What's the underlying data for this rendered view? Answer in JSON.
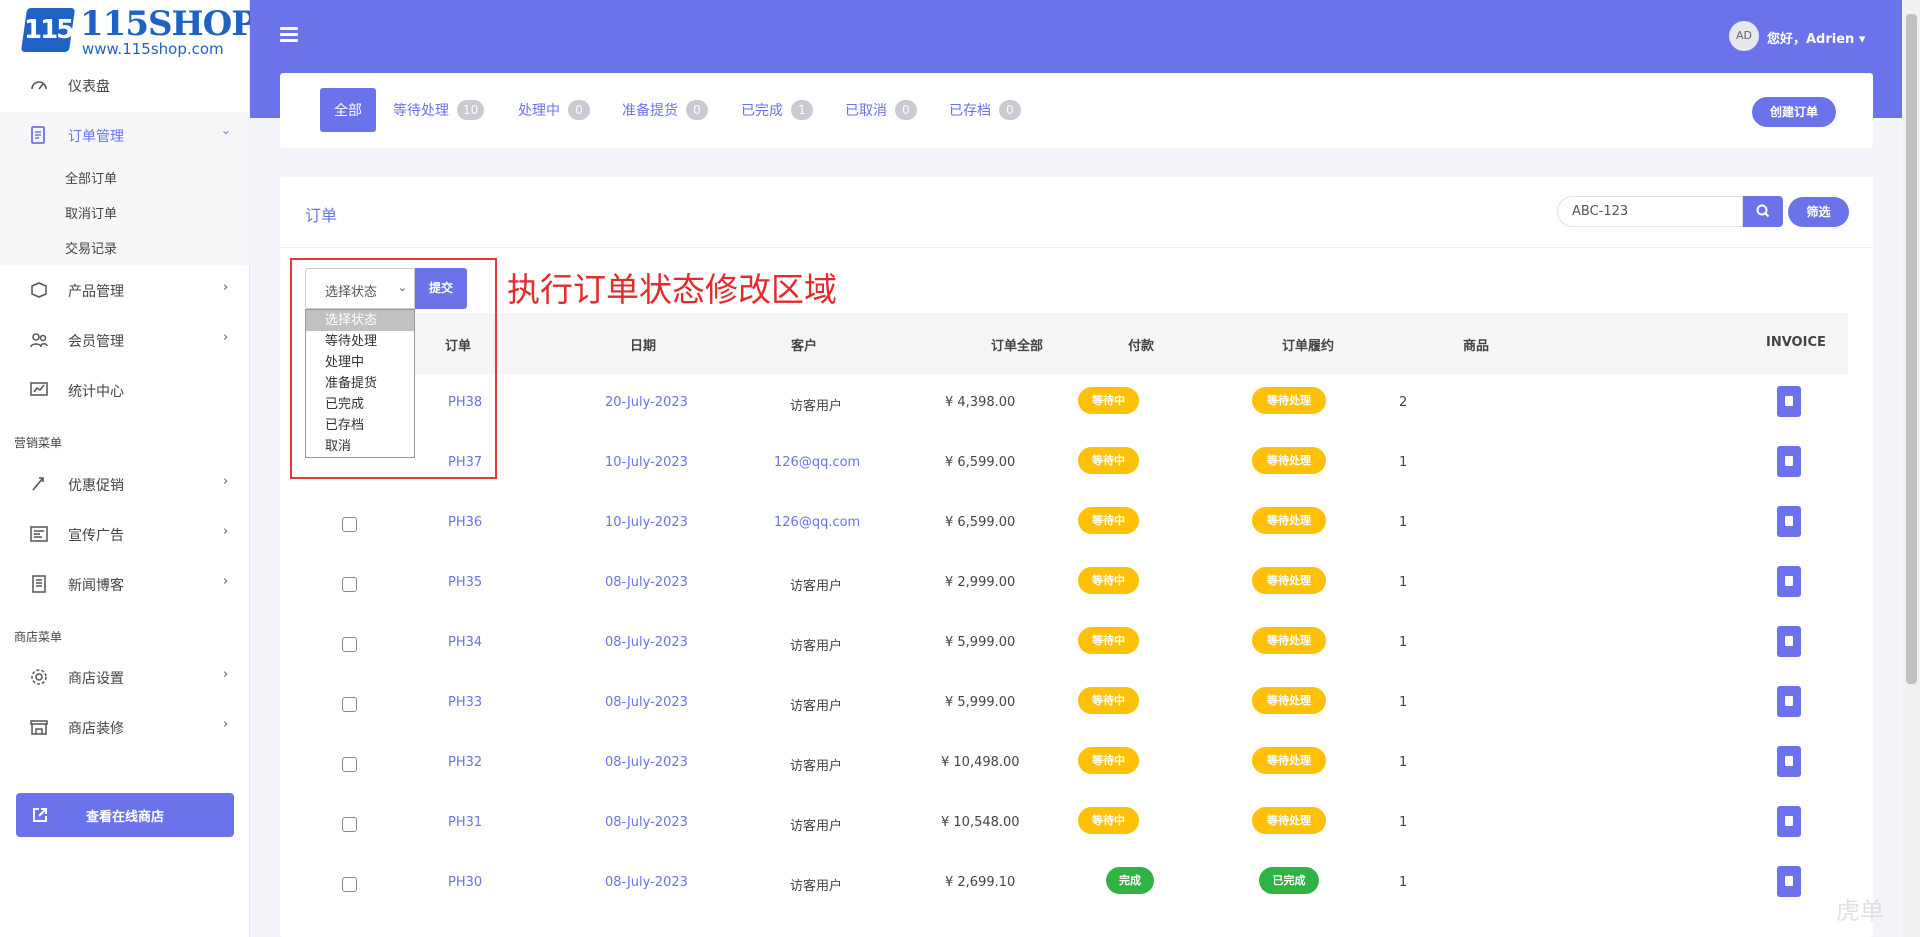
{
  "brand": {
    "name": "115SHOP",
    "url": "www.115shop.com",
    "mark": "115"
  },
  "header": {
    "avatar": "AD",
    "greeting": "您好，Adrien",
    "caret": "▾"
  },
  "sidebar": {
    "items": [
      {
        "label": "仪表盘",
        "icon": "dashboard-icon"
      },
      {
        "label": "订单管理",
        "icon": "order-icon",
        "expanded": true
      },
      {
        "label": "产品管理",
        "icon": "product-icon"
      },
      {
        "label": "会员管理",
        "icon": "members-icon"
      },
      {
        "label": "统计中心",
        "icon": "stats-icon"
      },
      {
        "label": "优惠促销",
        "icon": "promo-icon"
      },
      {
        "label": "宣传广告",
        "icon": "ads-icon"
      },
      {
        "label": "新闻博客",
        "icon": "news-icon"
      },
      {
        "label": "商店设置",
        "icon": "gear-icon"
      },
      {
        "label": "商店装修",
        "icon": "store-icon"
      }
    ],
    "order_sub": [
      "全部订单",
      "取消订单",
      "交易记录"
    ],
    "section_marketing": "营销菜单",
    "section_store": "商店菜单",
    "view_store": "查看在线商店"
  },
  "tabs": [
    {
      "label": "全部",
      "count": null,
      "active": true
    },
    {
      "label": "等待处理",
      "count": "10"
    },
    {
      "label": "处理中",
      "count": "0"
    },
    {
      "label": "准备提货",
      "count": "0"
    },
    {
      "label": "已完成",
      "count": "1"
    },
    {
      "label": "已取消",
      "count": "0"
    },
    {
      "label": "已存档",
      "count": "0"
    }
  ],
  "create_order": "创建订单",
  "orders": {
    "title": "订单",
    "search_value": "ABC-123",
    "filter": "筛选",
    "status_select": "选择状态",
    "submit": "提交",
    "status_options": [
      "选择状态",
      "等待处理",
      "处理中",
      "准备提货",
      "已完成",
      "已存档",
      "取消"
    ],
    "annotation": "执行订单状态修改区域",
    "columns": [
      "订单",
      "日期",
      "客户",
      "订单全部",
      "付款",
      "订单履约",
      "商品",
      "INVOICE"
    ],
    "rows": [
      {
        "id": "PH38",
        "date": "20-July-2023",
        "customer": "访客用户",
        "total": "¥ 4,398.00",
        "payment": "等待中",
        "fulfill": "等待处理",
        "items": "2"
      },
      {
        "id": "PH37",
        "date": "10-July-2023",
        "customer": "126@qq.com",
        "total": "¥ 6,599.00",
        "payment": "等待中",
        "fulfill": "等待处理",
        "items": "1"
      },
      {
        "id": "PH36",
        "date": "10-July-2023",
        "customer": "126@qq.com",
        "total": "¥ 6,599.00",
        "payment": "等待中",
        "fulfill": "等待处理",
        "items": "1"
      },
      {
        "id": "PH35",
        "date": "08-July-2023",
        "customer": "访客用户",
        "total": "¥ 2,999.00",
        "payment": "等待中",
        "fulfill": "等待处理",
        "items": "1"
      },
      {
        "id": "PH34",
        "date": "08-July-2023",
        "customer": "访客用户",
        "total": "¥ 5,999.00",
        "payment": "等待中",
        "fulfill": "等待处理",
        "items": "1"
      },
      {
        "id": "PH33",
        "date": "08-July-2023",
        "customer": "访客用户",
        "total": "¥ 5,999.00",
        "payment": "等待中",
        "fulfill": "等待处理",
        "items": "1"
      },
      {
        "id": "PH32",
        "date": "08-July-2023",
        "customer": "访客用户",
        "total": "¥ 10,498.00",
        "payment": "等待中",
        "fulfill": "等待处理",
        "items": "1"
      },
      {
        "id": "PH31",
        "date": "08-July-2023",
        "customer": "访客用户",
        "total": "¥ 10,548.00",
        "payment": "等待中",
        "fulfill": "等待处理",
        "items": "1"
      },
      {
        "id": "PH30",
        "date": "08-July-2023",
        "customer": "访客用户",
        "total": "¥ 2,699.10",
        "payment": "完成",
        "fulfill": "已完成",
        "items": "1"
      }
    ]
  },
  "watermark": "虎单",
  "colors": {
    "accent": "#6b73ea",
    "warning": "#ffc107",
    "success": "#2fb344",
    "annotation": "#e03a3a"
  }
}
